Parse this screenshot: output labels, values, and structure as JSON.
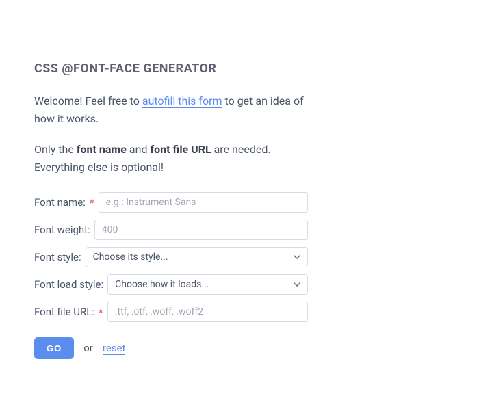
{
  "heading": "CSS @FONT-FACE GENERATOR",
  "intro": {
    "pre": "Welcome! Feel free to ",
    "link": "autofill this form",
    "post": " to get an idea of how it works."
  },
  "note": {
    "p1": "Only the ",
    "b1": "font name",
    "p2": " and ",
    "b2": "font file URL",
    "p3": " are needed. Everything else is optional!"
  },
  "form": {
    "font_name": {
      "label": "Font name:",
      "placeholder": "e.g.: Instrument Sans",
      "required": "*"
    },
    "font_weight": {
      "label": "Font weight:",
      "placeholder": "400"
    },
    "font_style": {
      "label": "Font style:",
      "placeholder": "Choose its style..."
    },
    "font_load": {
      "label": "Font load style:",
      "placeholder": "Choose how it loads..."
    },
    "font_url": {
      "label": "Font file URL:",
      "placeholder": ".ttf, .otf, .woff, .woff2",
      "required": "*"
    }
  },
  "actions": {
    "go": "GO",
    "or": "or",
    "reset": "reset"
  }
}
